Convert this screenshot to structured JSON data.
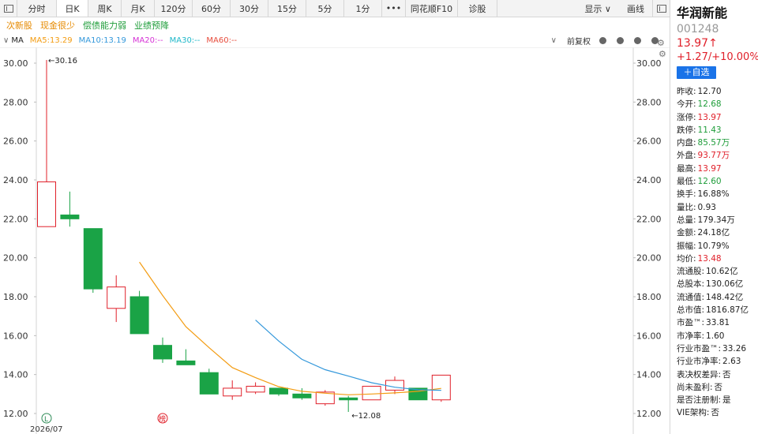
{
  "toolbar": {
    "tabs": [
      "分时",
      "日K",
      "周K",
      "月K",
      "120分",
      "60分",
      "30分",
      "15分",
      "5分",
      "1分",
      "•••",
      "同花顺F10",
      "诊股"
    ],
    "active_tab": 1,
    "display_label": "显示 ∨",
    "draw_label": "画线"
  },
  "tags": [
    "次新股",
    "现金很少",
    "偿债能力弱",
    "业绩预降"
  ],
  "ma": {
    "label": "MA",
    "ma5": "MA5:13.29",
    "ma10": "MA10:13.19",
    "ma20": "MA20:--",
    "ma30": "MA30:--",
    "ma60": "MA60:--",
    "adjust": "前复权",
    "colors": {
      "ma5": "#f39c12",
      "ma10": "#3498db",
      "ma20": "#d633d6",
      "ma30": "#1fb8c9",
      "ma60": "#e74c3c"
    }
  },
  "stock": {
    "name": "华润新能",
    "code": "001248",
    "price": "13.97↑",
    "change": "+1.27/+10.00%",
    "add_label": "＋自选"
  },
  "stats": [
    {
      "label": "昨收:",
      "value": "12.70",
      "color": "normal"
    },
    {
      "label": "今开:",
      "value": "12.68",
      "color": "green"
    },
    {
      "label": "涨停:",
      "value": "13.97",
      "color": "red"
    },
    {
      "label": "跌停:",
      "value": "11.43",
      "color": "green"
    },
    {
      "label": "内盘:",
      "value": "85.57万",
      "color": "green"
    },
    {
      "label": "外盘:",
      "value": "93.77万",
      "color": "red"
    },
    {
      "label": "最高:",
      "value": "13.97",
      "color": "red"
    },
    {
      "label": "最低:",
      "value": "12.60",
      "color": "green"
    },
    {
      "label": "换手:",
      "value": "16.88%",
      "color": "normal"
    },
    {
      "label": "量比:",
      "value": "0.93",
      "color": "normal"
    },
    {
      "label": "总量:",
      "value": "179.34万",
      "color": "normal"
    },
    {
      "label": "金额:",
      "value": "24.18亿",
      "color": "normal"
    },
    {
      "label": "振幅:",
      "value": "10.79%",
      "color": "normal"
    },
    {
      "label": "均价:",
      "value": "13.48",
      "color": "red"
    },
    {
      "label": "流通股:",
      "value": "10.62亿",
      "color": "normal"
    },
    {
      "label": "总股本:",
      "value": "130.06亿",
      "color": "normal"
    },
    {
      "label": "流通值:",
      "value": "148.42亿",
      "color": "normal"
    },
    {
      "label": "总市值:",
      "value": "1816.87亿",
      "color": "normal"
    },
    {
      "label": "市盈™:",
      "value": "33.81",
      "color": "normal"
    },
    {
      "label": "市净率:",
      "value": "1.60",
      "color": "normal"
    },
    {
      "label": "行业市盈™:",
      "value": "33.26",
      "color": "normal"
    },
    {
      "label": "行业市净率:",
      "value": "2.63",
      "color": "normal"
    },
    {
      "label": "表决权差异:",
      "value": "否",
      "color": "normal"
    },
    {
      "label": "尚未盈利:",
      "value": "否",
      "color": "normal"
    },
    {
      "label": "是否注册制:",
      "value": "是",
      "color": "normal"
    },
    {
      "label": "VIE架构:",
      "value": "否",
      "color": "normal"
    }
  ],
  "chart_data": {
    "type": "candlestick",
    "ylim": [
      12,
      30
    ],
    "yticks": [
      "12.00",
      "14.00",
      "16.00",
      "18.00",
      "20.00",
      "22.00",
      "24.00",
      "26.00",
      "28.00",
      "30.00"
    ],
    "x_label": "2026/07",
    "markers": {
      "L": "L",
      "bang": "榜"
    },
    "high_label": "←30.16",
    "low_label": "←12.08",
    "high": 30.16,
    "low": 12.08,
    "candles": [
      {
        "o": 21.6,
        "h": 30.16,
        "l": 21.6,
        "c": 23.9
      },
      {
        "o": 22.2,
        "h": 23.4,
        "l": 21.6,
        "c": 22.0
      },
      {
        "o": 21.5,
        "h": 21.5,
        "l": 18.2,
        "c": 18.4
      },
      {
        "o": 17.4,
        "h": 19.1,
        "l": 16.7,
        "c": 18.5
      },
      {
        "o": 18.0,
        "h": 18.3,
        "l": 16.1,
        "c": 16.1
      },
      {
        "o": 15.5,
        "h": 15.9,
        "l": 14.6,
        "c": 14.8
      },
      {
        "o": 14.7,
        "h": 15.3,
        "l": 14.5,
        "c": 14.5
      },
      {
        "o": 14.1,
        "h": 14.3,
        "l": 13.0,
        "c": 13.0
      },
      {
        "o": 12.9,
        "h": 13.7,
        "l": 12.7,
        "c": 13.3
      },
      {
        "o": 13.1,
        "h": 13.6,
        "l": 13.0,
        "c": 13.4
      },
      {
        "o": 13.3,
        "h": 13.3,
        "l": 12.9,
        "c": 13.0
      },
      {
        "o": 13.0,
        "h": 13.3,
        "l": 12.7,
        "c": 12.8
      },
      {
        "o": 12.5,
        "h": 13.2,
        "l": 12.4,
        "c": 13.1
      },
      {
        "o": 12.8,
        "h": 12.9,
        "l": 12.08,
        "c": 12.7
      },
      {
        "o": 12.7,
        "h": 13.4,
        "l": 12.7,
        "c": 13.4
      },
      {
        "o": 13.2,
        "h": 13.9,
        "l": 13.0,
        "c": 13.7
      },
      {
        "o": 13.3,
        "h": 13.3,
        "l": 12.7,
        "c": 12.7
      },
      {
        "o": 12.7,
        "h": 13.97,
        "l": 12.6,
        "c": 13.97
      }
    ],
    "ma5": [
      null,
      null,
      null,
      null,
      19.78,
      18.06,
      16.46,
      15.38,
      14.36,
      13.84,
      13.38,
      13.14,
      13.04,
      12.96,
      13.0,
      13.06,
      13.14,
      13.29
    ],
    "ma10": [
      null,
      null,
      null,
      null,
      null,
      null,
      null,
      null,
      null,
      16.8,
      15.72,
      14.78,
      14.25,
      13.92,
      13.58,
      13.35,
      13.22,
      13.19
    ]
  }
}
